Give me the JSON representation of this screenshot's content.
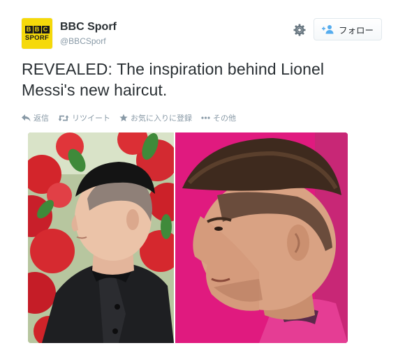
{
  "account": {
    "avatar_top": "BBC",
    "avatar_bottom": "SPORF",
    "display_name": "BBC Sporf",
    "screen_name": "@BBCSporf"
  },
  "follow_button": {
    "label": "フォロー"
  },
  "tweet": {
    "text_line1": "REVEALED: The inspiration behind Lionel",
    "text_line2": "Messi's new haircut."
  },
  "actions": {
    "reply": "返信",
    "retweet": "リツイート",
    "favorite": "お気に入りに登録",
    "more": "その他"
  },
  "icons": {
    "settings": "gear-icon",
    "follow": "add-user-icon",
    "reply": "reply-icon",
    "retweet": "retweet-icon",
    "favorite": "star-icon",
    "more": "ellipsis-icon"
  },
  "colors": {
    "avatar_bg": "#f5d90a",
    "text": "#292f33",
    "muted": "#8899a6",
    "follow_icon": "#55acee",
    "photo_right_bg": "#e0197d"
  }
}
